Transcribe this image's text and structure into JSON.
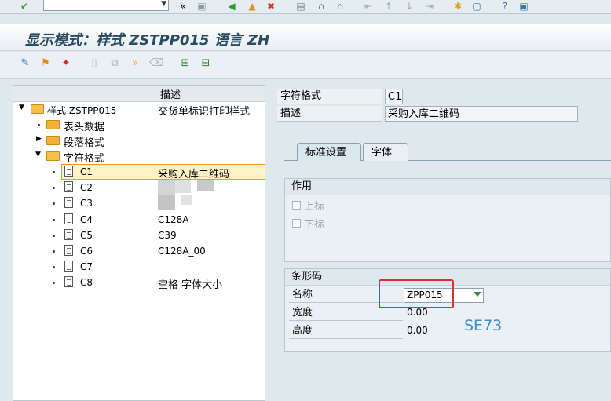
{
  "title": "显示模式：样式 ZSTPP015 语言 ZH",
  "tree": {
    "column_header": "描述",
    "rows": [
      {
        "label": "样式 ZSTPP015",
        "desc": "交货单标识打印样式"
      },
      {
        "label": "表头数据",
        "desc": ""
      },
      {
        "label": "段落格式",
        "desc": ""
      },
      {
        "label": "字符格式",
        "desc": ""
      },
      {
        "label": "C1",
        "desc": "采购入库二维码"
      },
      {
        "label": "C2",
        "desc": ""
      },
      {
        "label": "C3",
        "desc": ""
      },
      {
        "label": "C4",
        "desc": "C128A"
      },
      {
        "label": "C5",
        "desc": "C39"
      },
      {
        "label": "C6",
        "desc": "C128A_00"
      },
      {
        "label": "C7",
        "desc": ""
      },
      {
        "label": "C8",
        "desc": "空格 字体大小"
      }
    ]
  },
  "detail": {
    "char_format_label": "字符格式",
    "char_format_value": "C1",
    "desc_label": "描述",
    "desc_value": "采购入库二维码",
    "tabs": [
      {
        "label": "标准设置",
        "active": true
      },
      {
        "label": "字体",
        "active": false
      }
    ],
    "effect_group": {
      "title": "作用",
      "superscript": "上标",
      "subscript": "下标"
    },
    "barcode_group": {
      "title": "条形码",
      "name_label": "名称",
      "name_value": "ZPP015",
      "width_label": "宽度",
      "width_value": "0.00",
      "height_label": "高度",
      "height_value": "0.00"
    }
  },
  "annotation": "SE73",
  "colors": {
    "highlight_box": "#e0302d",
    "annotation": "#3b8fd6",
    "selection": "#f39c12"
  }
}
